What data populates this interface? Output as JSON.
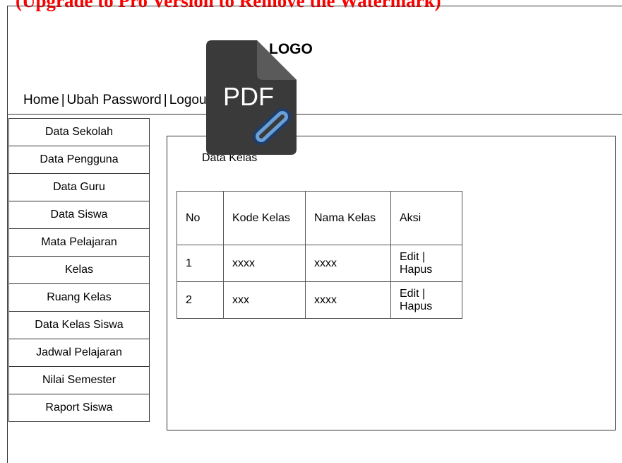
{
  "watermark": "(Upgrade to Pro Version to Remove the Watermark)",
  "header": {
    "logo": "LOGO"
  },
  "topnav": {
    "items": [
      "Home",
      "Ubah Password",
      "Logout"
    ],
    "separator": "|"
  },
  "sidebar": {
    "items": [
      {
        "label": "Data Sekolah"
      },
      {
        "label": "Data Pengguna"
      },
      {
        "label": "Data Guru"
      },
      {
        "label": "Data Siswa"
      },
      {
        "label": "Mata Pelajaran"
      },
      {
        "label": "Kelas"
      },
      {
        "label": "Ruang Kelas"
      },
      {
        "label": "Data Kelas Siswa"
      },
      {
        "label": "Jadwal Pelajaran"
      },
      {
        "label": "Nilai Semester"
      },
      {
        "label": "Raport Siswa"
      }
    ]
  },
  "content": {
    "title": "Data Kelas",
    "table": {
      "headers": [
        "No",
        "Kode Kelas",
        "Nama Kelas",
        "Aksi"
      ],
      "rows": [
        {
          "no": "1",
          "kode": "xxxx",
          "nama": "xxxx",
          "edit": "Edit |",
          "hapus": "Hapus"
        },
        {
          "no": "2",
          "kode": "xxx",
          "nama": "xxxx",
          "edit": "Edit |",
          "hapus": "Hapus"
        }
      ]
    }
  },
  "overlay": {
    "icon_text": "PDF",
    "icon": "pdf-link-icon",
    "colors": {
      "body": "#3a3a3a",
      "fold": "#5a5a5a",
      "link": "#6aa0d8"
    }
  }
}
